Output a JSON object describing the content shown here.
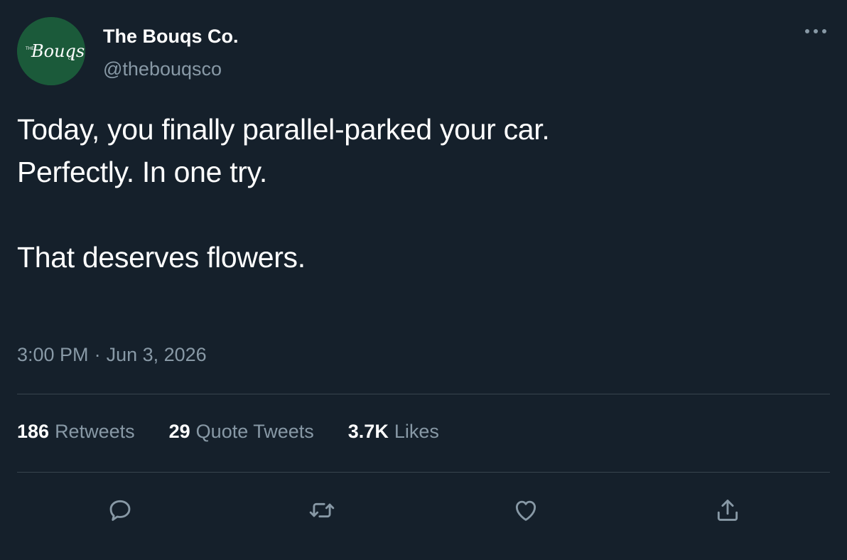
{
  "author": {
    "display_name": "The Bouqs Co.",
    "handle": "@thebouqsco",
    "avatar_icon": "bouqs-logo-icon",
    "avatar_color": "#1b5a3a"
  },
  "tweet": {
    "text": "Today, you finally parallel-parked your car.\nPerfectly. In one try.\n\nThat deserves flowers.",
    "time": "3:00 PM",
    "separator": "·",
    "date": "Jun 3, 2026"
  },
  "stats": {
    "retweets": {
      "count": "186",
      "label": "Retweets"
    },
    "quote_tweets": {
      "count": "29",
      "label": "Quote Tweets"
    },
    "likes": {
      "count": "3.7K",
      "label": "Likes"
    }
  },
  "actions": {
    "reply_icon": "reply-icon",
    "retweet_icon": "retweet-icon",
    "like_icon": "heart-icon",
    "share_icon": "share-icon"
  },
  "menu": {
    "icon": "more-options-icon"
  },
  "colors": {
    "background": "#15202b",
    "text_primary": "#ffffff",
    "text_secondary": "#8899a6",
    "divider": "#38444d"
  }
}
